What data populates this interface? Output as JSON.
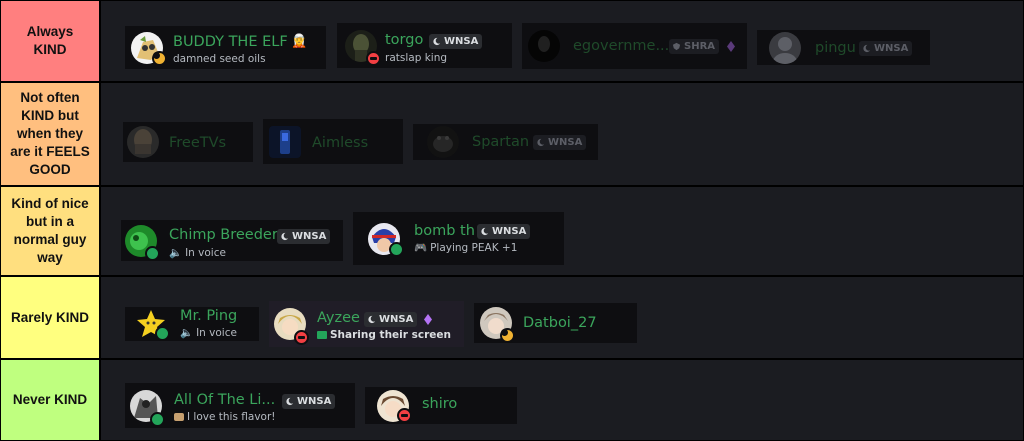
{
  "tiers": [
    {
      "label_lines": [
        "Always",
        "KIND"
      ],
      "color": "#ff7f7f",
      "members": [
        {
          "name": "BUDDY THE ELF",
          "emoji": "🧝",
          "subtext": "damned seed oils",
          "status": "idle"
        },
        {
          "name": "torgo",
          "tag": "WNSA",
          "subtext": "ratslap king",
          "status": "dnd"
        },
        {
          "name": "egovernme...",
          "tag": "SHRA",
          "gem": true
        },
        {
          "name": "pingu",
          "tag": "WNSA"
        }
      ]
    },
    {
      "label_lines": [
        "Not often",
        "KIND but",
        "when they",
        "are it FEELS",
        "GOOD"
      ],
      "color": "#ffbf7f",
      "members": [
        {
          "name": "FreeTVs"
        },
        {
          "name": "Aimless"
        },
        {
          "name": "Spartan",
          "tag": "WNSA"
        }
      ]
    },
    {
      "label_lines": [
        "Kind of nice",
        "but in a",
        "normal guy",
        "way"
      ],
      "color": "#ffdf7f",
      "members": [
        {
          "name": "Chimp Breeder",
          "tag": "WNSA",
          "subtext": "In voice",
          "status": "online"
        },
        {
          "name": "bomb th",
          "tag": "WNSA",
          "subtext": "Playing PEAK +1",
          "status": "online"
        }
      ]
    },
    {
      "label_lines": [
        "Rarely KIND"
      ],
      "color": "#ffff7f",
      "members": [
        {
          "name": "Mr. Ping",
          "subtext": "In voice",
          "status": "online"
        },
        {
          "name": "Ayzee",
          "tag": "WNSA",
          "gem": true,
          "subtext": "Sharing their screen",
          "status": "dnd"
        },
        {
          "name": "Datboi_27",
          "status": "idle"
        }
      ]
    },
    {
      "label_lines": [
        "Never KIND"
      ],
      "color": "#bfff7f",
      "members": [
        {
          "name": "All Of The Li...",
          "tag": "WNSA",
          "subtext": "I love this flavor!",
          "status": "online"
        },
        {
          "name": "shiro",
          "status": "dnd"
        }
      ]
    }
  ],
  "colors": {
    "name_green": "#3ba55c",
    "tag_bg": "#2b2d31",
    "gem_purple": "#b473f5",
    "status_online": "#23a55a",
    "status_dnd": "#f23f43",
    "status_idle": "#f0b232",
    "tray_bg": "#1b1c21"
  }
}
